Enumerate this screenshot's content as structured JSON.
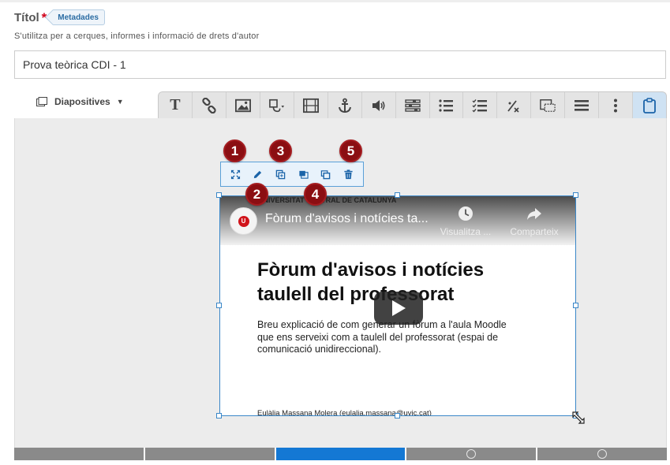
{
  "form": {
    "title_label": "Títol",
    "required_mark": "*",
    "metadata_tag": "Metadades",
    "hint": "S'utilitza per a cerques, informes i informació de drets d'autor",
    "title_value": "Prova teòrica CDI - 1"
  },
  "editor": {
    "slides_dropdown_label": "Diapositives",
    "toolbar_icons": [
      "text-icon",
      "link-icon",
      "image-icon",
      "shape-icon",
      "video-icon",
      "anchor-icon",
      "audio-icon",
      "form-icon",
      "numbered-list-icon",
      "checklist-icon",
      "math-icon",
      "hotspot-icon",
      "list-icon",
      "more-icon",
      "clipboard-icon"
    ],
    "floating_toolbar_icons": [
      "fullscreen-icon",
      "edit-icon",
      "duplicate-icon",
      "send-to-back-icon",
      "bring-to-front-icon",
      "delete-icon"
    ]
  },
  "badges": [
    "1",
    "2",
    "3",
    "4",
    "5"
  ],
  "video": {
    "university_strip": "UNIVERSITAT CENTRAL DE CATALUNYA",
    "title": "Fòrum d'avisos i notícies ta...",
    "watch_later_label": "Visualitza ...",
    "share_label": "Comparteix",
    "heading_line1": "Fòrum d'avisos i notícies",
    "heading_line2": "taulell del professorat",
    "description": "Breu explicació de com generar un fòrum a l'aula Moodle que ens serveixi com a taulell del professorat (espai de comunicació unidireccional).",
    "author": "Eulàlia Massana Molera (eulalia.massana@uvic.cat)"
  },
  "slides": {
    "count": 5,
    "active_index": 2
  },
  "colors": {
    "accent": "#1478d4",
    "badge": "#8b0e12",
    "required": "#d0021b"
  }
}
